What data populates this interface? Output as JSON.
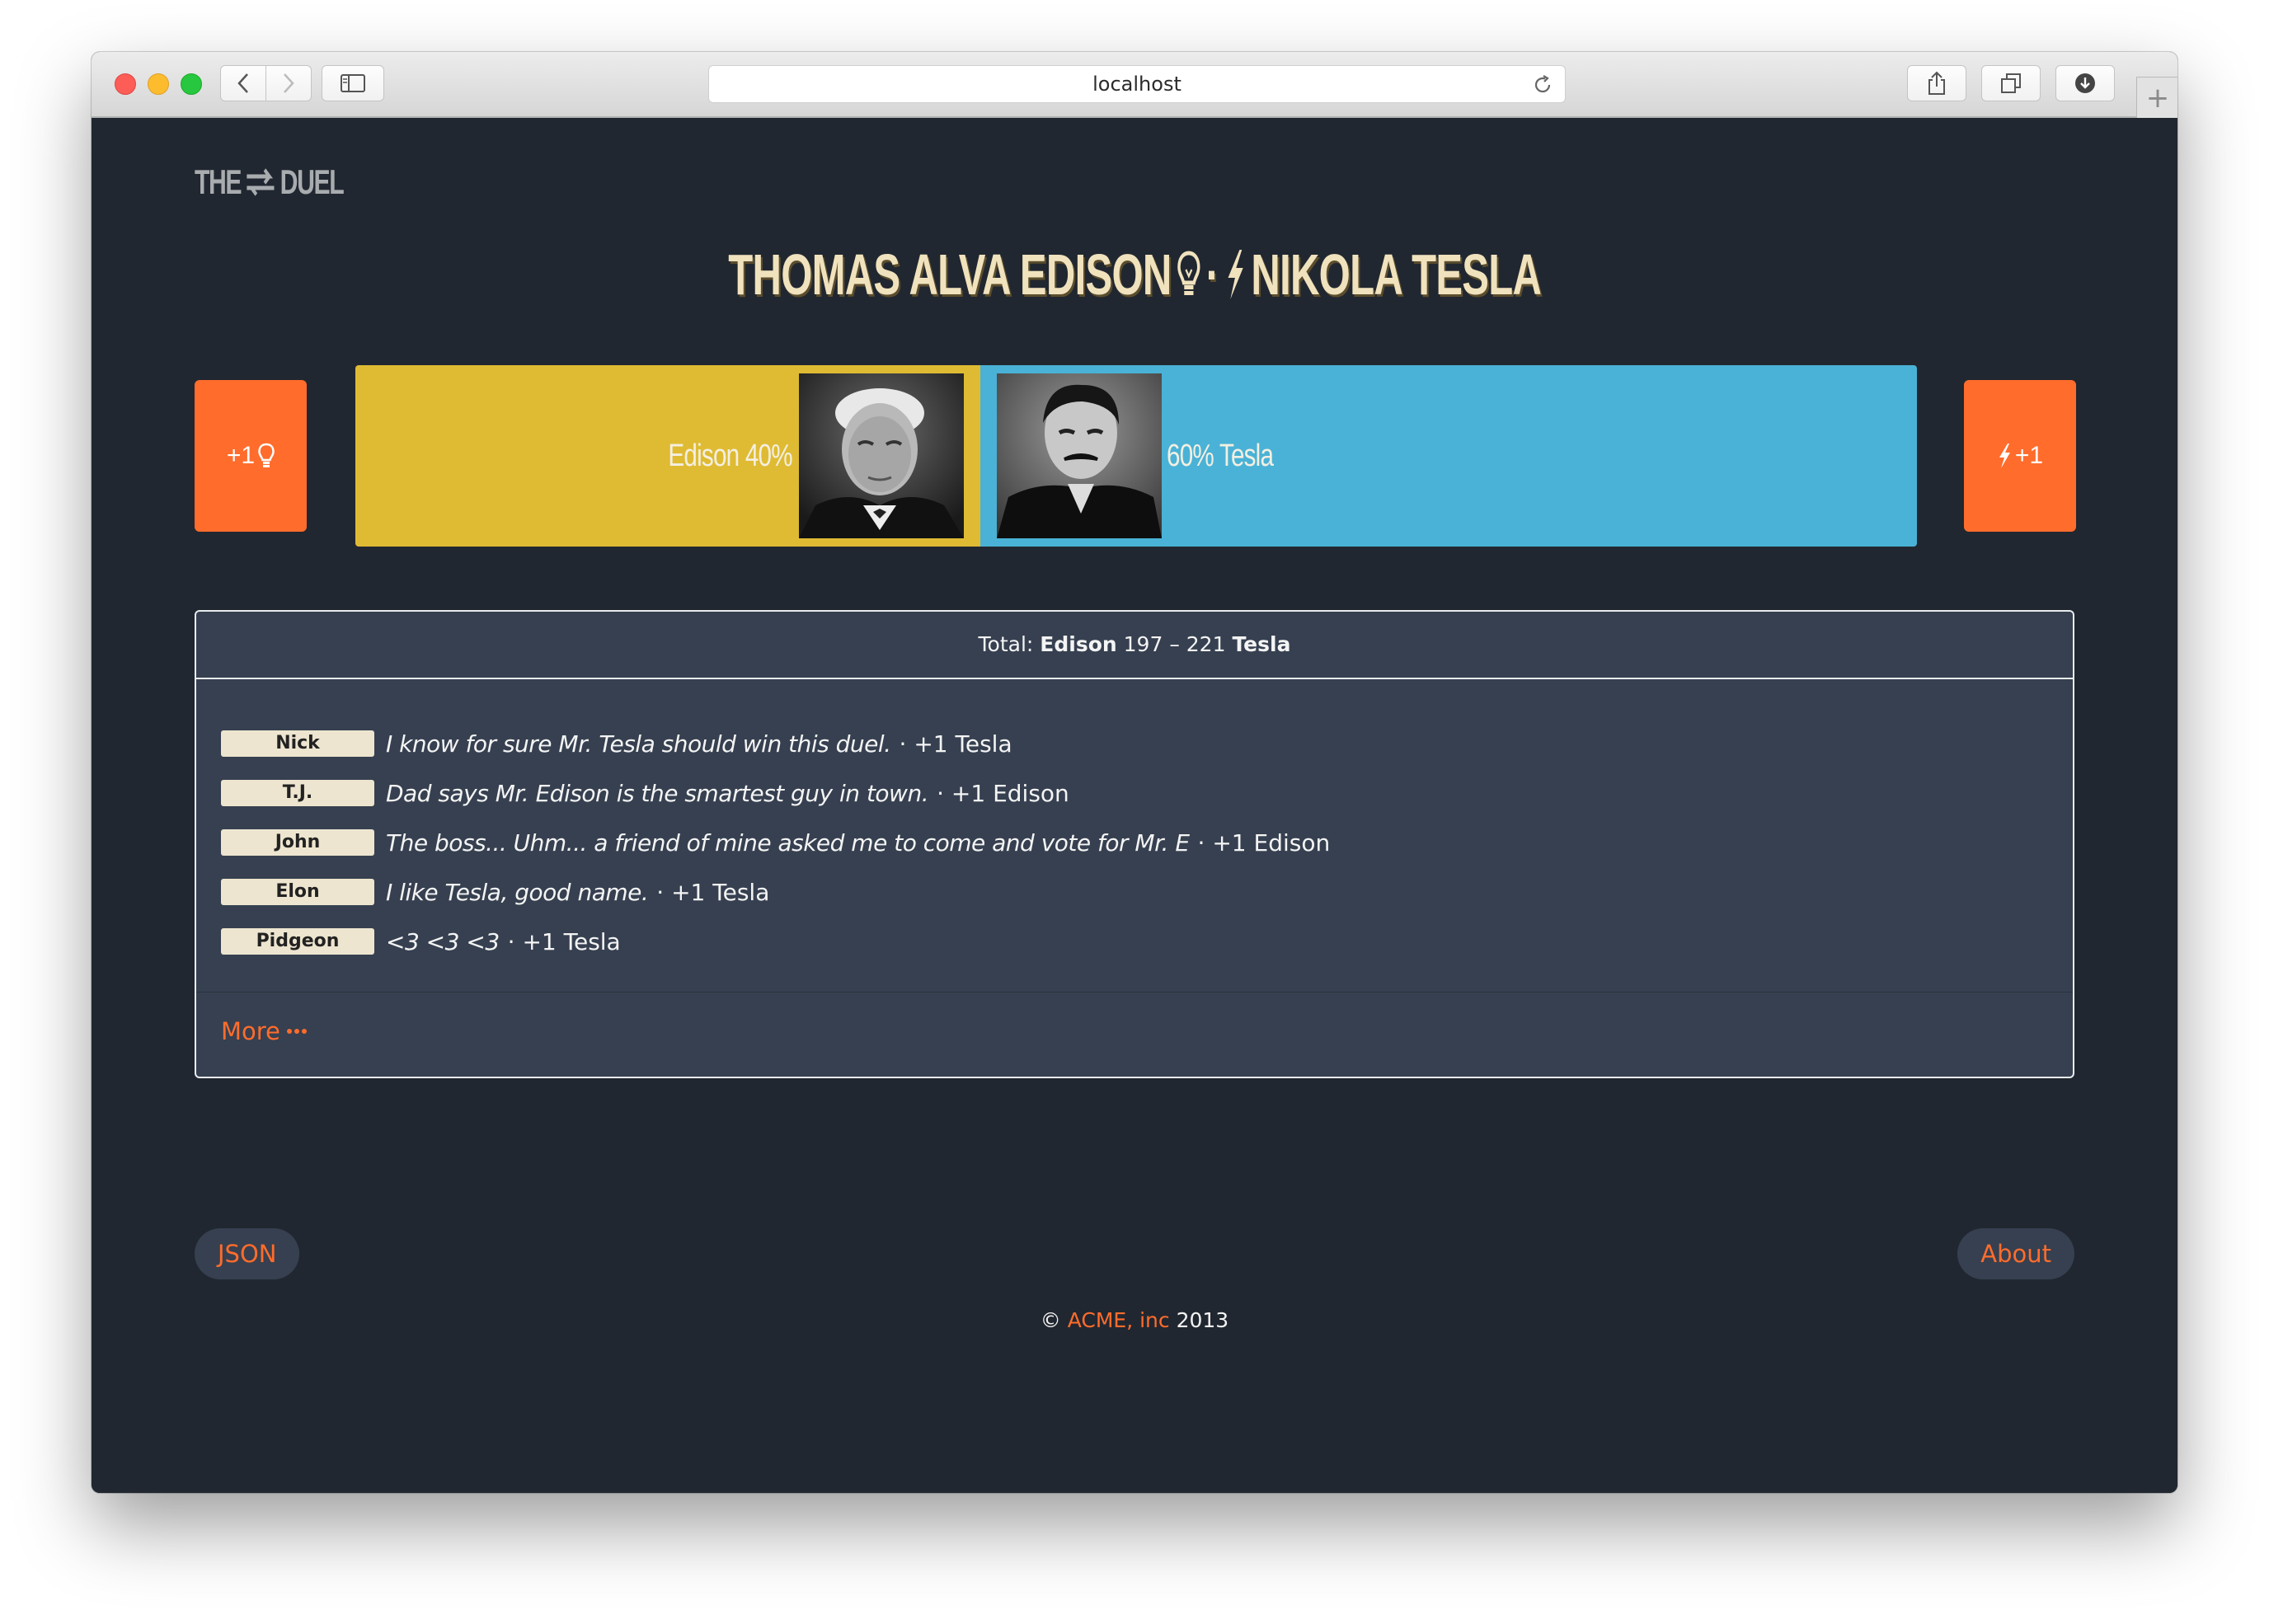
{
  "browser": {
    "url": "localhost"
  },
  "logo": {
    "left_text": "THE",
    "right_text": "DUEL"
  },
  "headline": {
    "left": "THOMAS ALVA EDISON",
    "separator": "·",
    "right": "NIKOLA TESLA"
  },
  "vote_buttons": {
    "edison_label": "+1",
    "tesla_label": "+1"
  },
  "scoreboard": {
    "edison_label": "Edison 40%",
    "tesla_label": "60% Tesla",
    "edison_share": 0.4,
    "tesla_share": 0.6,
    "edison_color": "#dfbb33",
    "tesla_color": "#4ab2d6"
  },
  "totals": {
    "prefix": "Total:",
    "edison_name": "Edison",
    "score_text": "197 – 221",
    "tesla_name": "Tesla"
  },
  "entries": [
    {
      "name": "Nick",
      "comment": "I know for sure Mr. Tesla should win this duel.",
      "vote": "· +1 Tesla"
    },
    {
      "name": "T.J.",
      "comment": "Dad says Mr. Edison is the smartest guy in town.",
      "vote": "· +1 Edison"
    },
    {
      "name": "John",
      "comment": "The boss... Uhm... a friend of mine asked me to come and vote for Mr. E",
      "vote": "· +1 Edison"
    },
    {
      "name": "Elon",
      "comment": "I like Tesla, good name.",
      "vote": "· +1 Tesla"
    },
    {
      "name": "Pidgeon",
      "comment": "<3 <3 <3",
      "vote": "· +1 Tesla"
    }
  ],
  "more_link": "More",
  "footer_links": {
    "json": "JSON",
    "about": "About"
  },
  "footer": {
    "copyright": "©",
    "company": "ACME, inc",
    "year": "2013"
  },
  "colors": {
    "accent": "#ff6c2c",
    "background": "#212730",
    "panel": "#364050",
    "headline": "#f0e2bd"
  }
}
